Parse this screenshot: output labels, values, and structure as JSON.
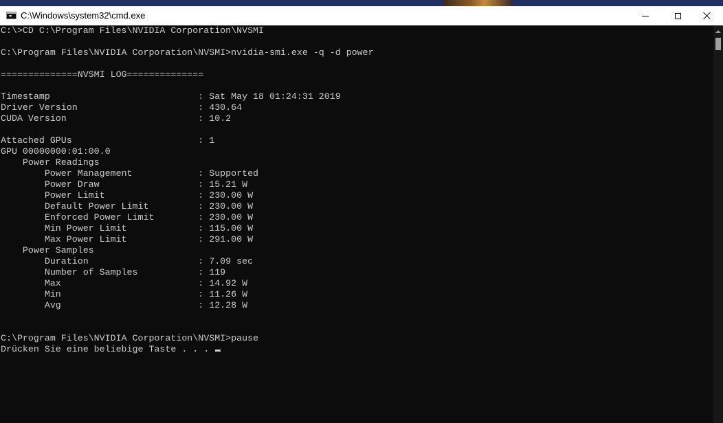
{
  "window": {
    "title": "C:\\Windows\\system32\\cmd.exe",
    "icon": "console-app-icon",
    "controls": [
      "minimize-icon",
      "maximize-icon",
      "close-icon"
    ]
  },
  "console": {
    "lines": [
      "C:\\>CD C:\\Program Files\\NVIDIA Corporation\\NVSMI",
      "",
      "C:\\Program Files\\NVIDIA Corporation\\NVSMI>nvidia-smi.exe -q -d power",
      "",
      "==============NVSMI LOG==============",
      "",
      "Timestamp                           : Sat May 18 01:24:31 2019",
      "Driver Version                      : 430.64",
      "CUDA Version                        : 10.2",
      "",
      "Attached GPUs                       : 1",
      "GPU 00000000:01:00.0",
      "    Power Readings",
      "        Power Management            : Supported",
      "        Power Draw                  : 15.21 W",
      "        Power Limit                 : 230.00 W",
      "        Default Power Limit         : 230.00 W",
      "        Enforced Power Limit        : 230.00 W",
      "        Min Power Limit             : 115.00 W",
      "        Max Power Limit             : 291.00 W",
      "    Power Samples",
      "        Duration                    : 7.09 sec",
      "        Number of Samples           : 119",
      "        Max                         : 14.92 W",
      "        Min                         : 11.26 W",
      "        Avg                         : 12.28 W",
      "",
      "",
      "C:\\Program Files\\NVIDIA Corporation\\NVSMI>pause"
    ],
    "prompt_line": "Drücken Sie eine beliebige Taste . . . ",
    "text_color": "#cccccc",
    "background_color": "#0c0c0c"
  }
}
